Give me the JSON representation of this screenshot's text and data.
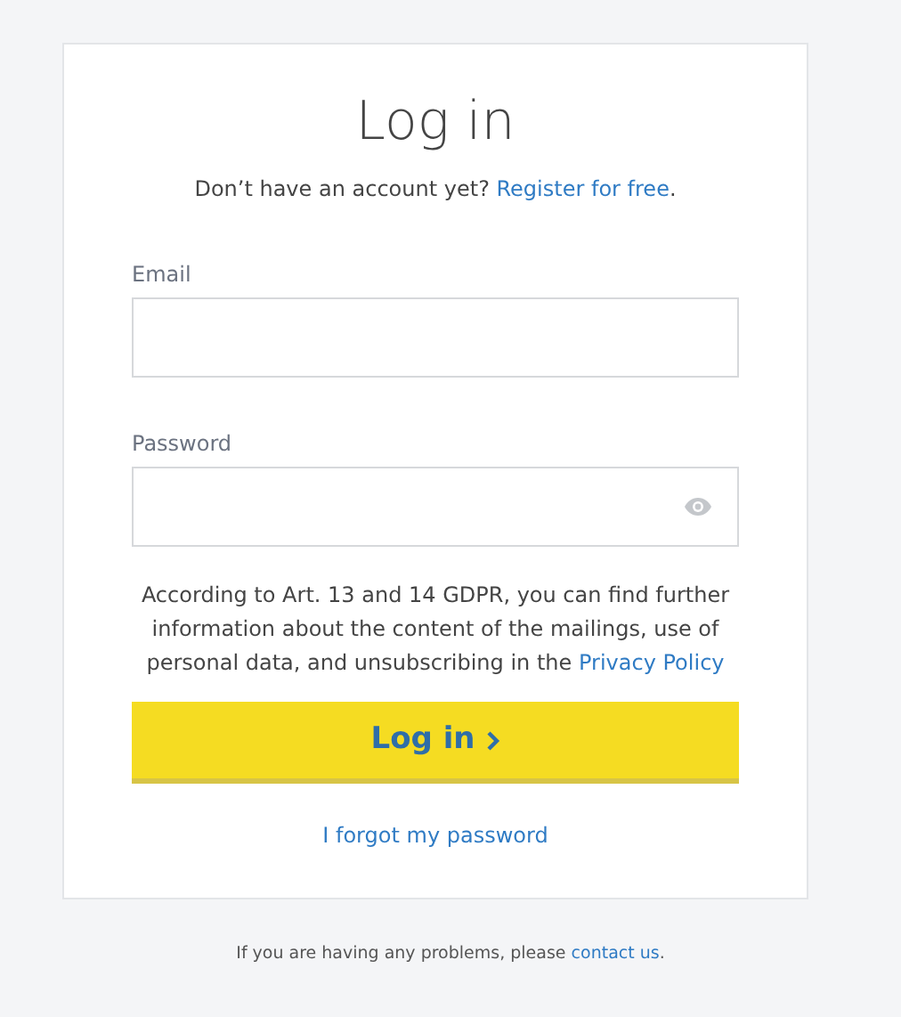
{
  "title": "Log in",
  "register": {
    "text": "Don’t have an account yet?",
    "link": "Register for free",
    "suffix": "."
  },
  "fields": [
    {
      "label": "Email",
      "kind": "text"
    },
    {
      "label": "Password",
      "kind": "password"
    }
  ],
  "notice": {
    "text": "According to Art. 13 and 14 GDPR, you can find further information about the content of the mailings, use of personal data, and unsubscribing in the",
    "link": "Privacy Policy"
  },
  "submit": "Log in",
  "forgot": "I forgot my password",
  "footer": {
    "text": "If you are having any problems, please",
    "link": "contact us",
    "suffix": "."
  }
}
